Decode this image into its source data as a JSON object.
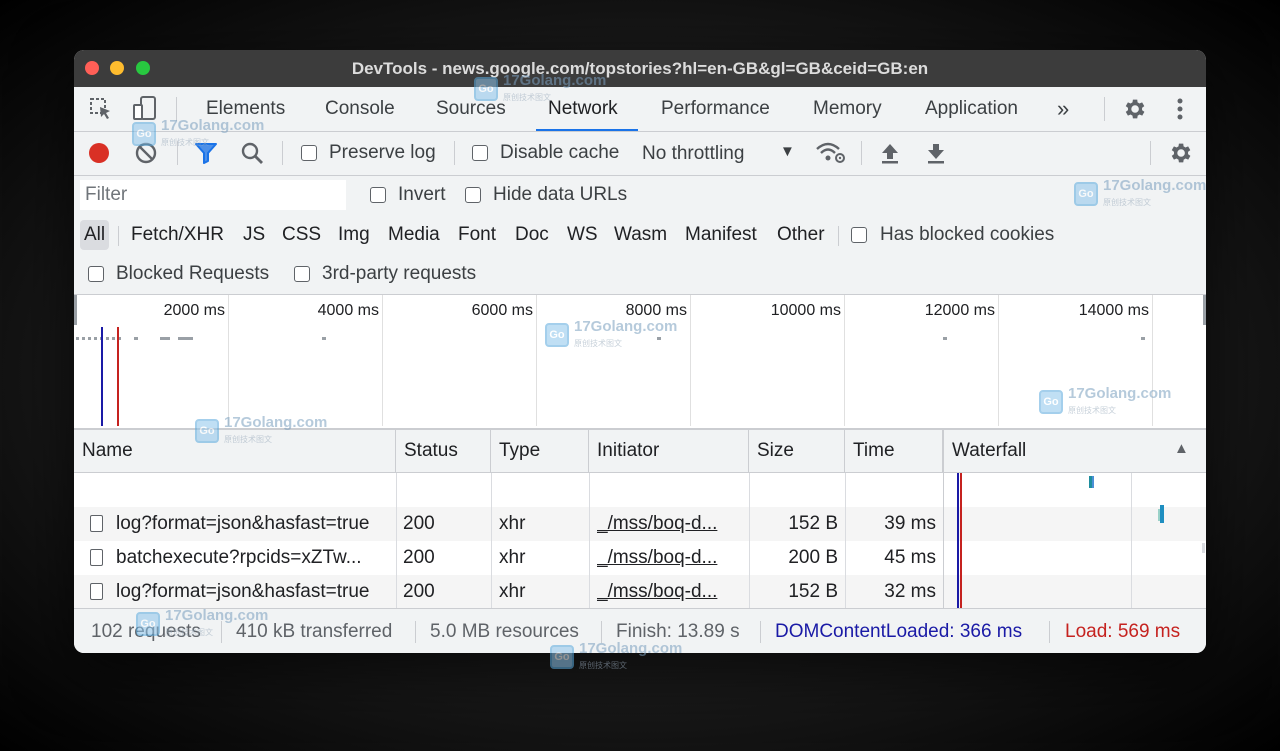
{
  "window": {
    "title": "DevTools - news.google.com/topstories?hl=en-GB&gl=GB&ceid=GB:en"
  },
  "tabs": [
    {
      "label": "Elements",
      "active": false
    },
    {
      "label": "Console",
      "active": false
    },
    {
      "label": "Sources",
      "active": false
    },
    {
      "label": "Network",
      "active": true
    },
    {
      "label": "Performance",
      "active": false
    },
    {
      "label": "Memory",
      "active": false
    },
    {
      "label": "Application",
      "active": false
    }
  ],
  "tabbar": {
    "more_label": "»",
    "icons": [
      "inspect-element-icon",
      "device-toolbar-icon",
      "settings-icon",
      "more-menu-icon"
    ]
  },
  "toolbar": {
    "record_color": "#d93025",
    "preserve_log": {
      "label": "Preserve log",
      "checked": false
    },
    "disable_cache": {
      "label": "Disable cache",
      "checked": false
    },
    "throttling": {
      "value": "No throttling",
      "arrow": "▼"
    },
    "icons": [
      "record-icon",
      "clear-icon",
      "filter-icon",
      "search-icon",
      "network-conditions-icon",
      "import-har-icon",
      "export-har-icon",
      "settings-icon"
    ]
  },
  "filter": {
    "placeholder": "Filter",
    "invert": {
      "label": "Invert",
      "checked": false
    },
    "hide_data_urls": {
      "label": "Hide data URLs",
      "checked": false
    },
    "types": [
      "All",
      "Fetch/XHR",
      "JS",
      "CSS",
      "Img",
      "Media",
      "Font",
      "Doc",
      "WS",
      "Wasm",
      "Manifest",
      "Other"
    ],
    "selected_type": "All",
    "has_blocked_cookies": {
      "label": "Has blocked cookies",
      "checked": false
    },
    "blocked_requests": {
      "label": "Blocked Requests",
      "checked": false
    },
    "third_party": {
      "label": "3rd-party requests",
      "checked": false
    }
  },
  "overview": {
    "ticks": [
      "2000 ms",
      "4000 ms",
      "6000 ms",
      "8000 ms",
      "10000 ms",
      "12000 ms",
      "14000 ms"
    ],
    "dom_content_loaded_color": "#1a1aa6",
    "load_color": "#c5221f"
  },
  "table": {
    "columns": [
      "Name",
      "Status",
      "Type",
      "Initiator",
      "Size",
      "Time",
      "Waterfall"
    ],
    "sort_indicator": "▲",
    "rows": [
      {
        "name": "log?format=json&hasfast=true",
        "status": "200",
        "type": "xhr",
        "initiator": "_/mss/boq-d...",
        "size": "152 B",
        "time": "39 ms"
      },
      {
        "name": "batchexecute?rpcids=xZTw...",
        "status": "200",
        "type": "xhr",
        "initiator": "_/mss/boq-d...",
        "size": "200 B",
        "time": "45 ms"
      },
      {
        "name": "log?format=json&hasfast=true",
        "status": "200",
        "type": "xhr",
        "initiator": "_/mss/boq-d...",
        "size": "152 B",
        "time": "32 ms"
      }
    ]
  },
  "status": {
    "requests": "102 requests",
    "transferred": "410 kB transferred",
    "resources": "5.0 MB resources",
    "finish": "Finish: 13.89 s",
    "dom_content_loaded": "DOMContentLoaded: 366 ms",
    "load": "Load: 569 ms",
    "dcl_color": "#1a1aa6",
    "load_color": "#c5221f"
  },
  "watermark": {
    "logo": "Go",
    "text": "17Golang.com",
    "sub": "原创技术图文"
  }
}
